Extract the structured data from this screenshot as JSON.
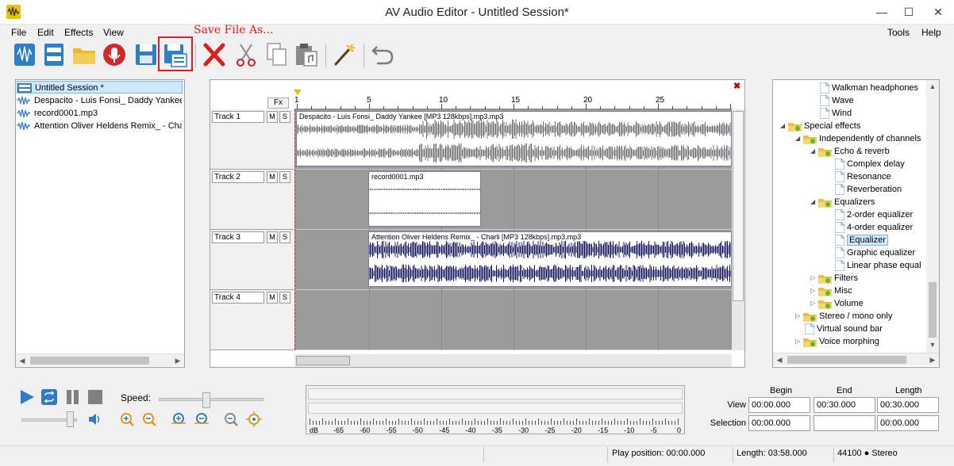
{
  "window": {
    "title": "AV Audio Editor - Untitled Session*",
    "minimize_glyph": "—",
    "maximize_glyph": "☐",
    "close_glyph": "✕"
  },
  "menu": {
    "left": [
      "File",
      "Edit",
      "Effects",
      "View"
    ],
    "right": [
      "Tools",
      "Help"
    ]
  },
  "toolbar": {
    "callout": "Save File As...",
    "buttons": [
      {
        "name": "new-session-icon"
      },
      {
        "name": "new-track-icon"
      },
      {
        "name": "open-folder-icon"
      },
      {
        "name": "record-icon"
      },
      {
        "name": "save-icon"
      },
      {
        "name": "save-as-icon"
      },
      {
        "name": "delete-icon"
      },
      {
        "name": "cut-icon"
      },
      {
        "name": "copy-icon"
      },
      {
        "name": "paste-icon"
      },
      {
        "name": "magic-wand-icon"
      },
      {
        "name": "undo-icon"
      }
    ]
  },
  "sessions": [
    {
      "label": "Untitled Session *",
      "selected": true
    },
    {
      "label": "Despacito - Luis Fonsi_ Daddy Yankee",
      "selected": false
    },
    {
      "label": "record0001.mp3",
      "selected": false
    },
    {
      "label": "Attention Oliver Heldens Remix_ - Charli",
      "selected": false
    }
  ],
  "tracks": {
    "fx_label": "Fx",
    "ruler_labels": [
      "1",
      "5",
      "10",
      "15",
      "20",
      "25"
    ],
    "mute_label": "M",
    "solo_label": "S",
    "close_glyph": "✖",
    "items": [
      {
        "name": "Track 1",
        "clip": "Despacito - Luis Fonsi_ Daddy Yankee [MP3 128kbps].mp3.mp3"
      },
      {
        "name": "Track 2",
        "clip": "record0001.mp3"
      },
      {
        "name": "Track 3",
        "clip": "Attention Oliver Heldens Remix_ - Charli [MP3 128kbps].mp3.mp3"
      },
      {
        "name": "Track 4",
        "clip": ""
      }
    ]
  },
  "effects_tree": [
    {
      "label": "Walkman headphones",
      "level": 2,
      "type": "file"
    },
    {
      "label": "Wave",
      "level": 2,
      "type": "file"
    },
    {
      "label": "Wind",
      "level": 2,
      "type": "file"
    },
    {
      "label": "Special effects",
      "level": 0,
      "type": "folder",
      "expanded": true
    },
    {
      "label": "Independently of channels",
      "level": 1,
      "type": "folder",
      "expanded": true
    },
    {
      "label": "Echo & reverb",
      "level": 2,
      "type": "folder",
      "expanded": true
    },
    {
      "label": "Complex delay",
      "level": 3,
      "type": "file"
    },
    {
      "label": "Resonance",
      "level": 3,
      "type": "file"
    },
    {
      "label": "Reverberation",
      "level": 3,
      "type": "file"
    },
    {
      "label": "Equalizers",
      "level": 2,
      "type": "folder",
      "expanded": true
    },
    {
      "label": "2-order equalizer",
      "level": 3,
      "type": "file"
    },
    {
      "label": "4-order equalizer",
      "level": 3,
      "type": "file"
    },
    {
      "label": "Equalizer",
      "level": 3,
      "type": "file",
      "selected": true
    },
    {
      "label": "Graphic equalizer",
      "level": 3,
      "type": "file"
    },
    {
      "label": "Linear phase equal",
      "level": 3,
      "type": "file"
    },
    {
      "label": "Filters",
      "level": 2,
      "type": "folder",
      "expanded": false
    },
    {
      "label": "Misc",
      "level": 2,
      "type": "folder",
      "expanded": false
    },
    {
      "label": "Volume",
      "level": 2,
      "type": "folder",
      "expanded": false
    },
    {
      "label": "Stereo / mono only",
      "level": 1,
      "type": "folder",
      "expanded": false
    },
    {
      "label": "Virtual sound bar",
      "level": 1,
      "type": "file"
    },
    {
      "label": "Voice morphing",
      "level": 1,
      "type": "folder",
      "expanded": false
    }
  ],
  "transport": {
    "speed_label": "Speed:",
    "speed_value": 0.45,
    "volume_value": 0.9
  },
  "meter": {
    "labels": [
      "dB",
      "-65",
      "-60",
      "-55",
      "-50",
      "-45",
      "-40",
      "-35",
      "-30",
      "-25",
      "-20",
      "-15",
      "-10",
      "-5",
      "0"
    ]
  },
  "selection": {
    "headers": {
      "begin": "Begin",
      "end": "End",
      "length": "Length"
    },
    "view_label": "View",
    "selection_label": "Selection",
    "view": {
      "begin": "00:00.000",
      "end": "00:30.000",
      "length": "00:30.000"
    },
    "sel": {
      "begin": "00:00.000",
      "end": "",
      "length": "00:00.000"
    }
  },
  "status": {
    "play_position": "Play position: 00:00.000",
    "length": "Length: 03:58.000",
    "format": "44100 ● Stereo"
  },
  "colors": {
    "wave_gray": "#6f6f6f",
    "wave_navy": "#14145c",
    "lane_bg": "#9b9b9b",
    "highlight": "#e02020"
  }
}
